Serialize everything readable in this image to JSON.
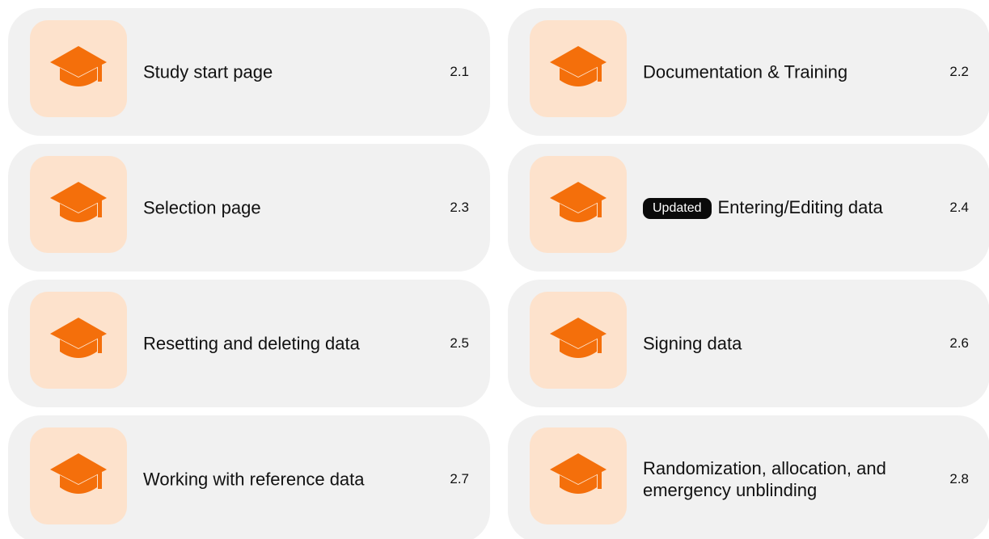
{
  "accent_color": "#f46f0b",
  "icon_bg_color": "#fde2cc",
  "card_bg_color": "#f1f1f1",
  "cards": [
    {
      "title": "Study start page",
      "number": "2.1",
      "icon": "graduation-cap-icon"
    },
    {
      "title": "Documentation & Training",
      "number": "2.2",
      "icon": "graduation-cap-icon"
    },
    {
      "title": "Selection page",
      "number": "2.3",
      "icon": "graduation-cap-icon"
    },
    {
      "badge": "Updated",
      "title": "Entering/Editing data",
      "number": "2.4",
      "icon": "graduation-cap-icon"
    },
    {
      "title": "Resetting and deleting data",
      "number": "2.5",
      "icon": "graduation-cap-icon"
    },
    {
      "title": "Signing data",
      "number": "2.6",
      "icon": "graduation-cap-icon"
    },
    {
      "title": "Working with reference data",
      "number": "2.7",
      "icon": "graduation-cap-icon"
    },
    {
      "title": "Randomization, allocation, and emergency unblinding",
      "number": "2.8",
      "icon": "graduation-cap-icon"
    }
  ]
}
